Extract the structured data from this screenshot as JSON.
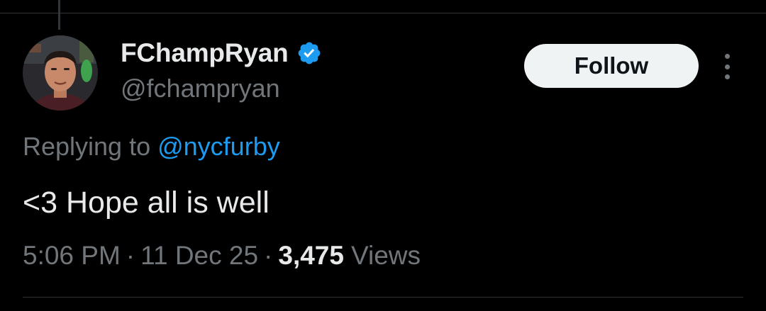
{
  "tweet": {
    "author": {
      "display_name": "FChampRyan",
      "handle": "@fchampryan",
      "verified_icon": "verified-badge-icon",
      "verified_color": "#1d9bf0"
    },
    "follow_label": "Follow",
    "more_icon": "more-vertical-icon",
    "reply": {
      "prefix": "Replying to ",
      "mention": "@nycfurby"
    },
    "text": "<3 Hope all is well",
    "meta": {
      "time": "5:06 PM",
      "separator": "·",
      "date": "11 Dec 25",
      "views_count": "3,475",
      "views_label": "Views"
    }
  },
  "colors": {
    "background": "#000000",
    "primary_text": "#e7e9ea",
    "secondary_text": "#71767b",
    "accent": "#1d9bf0",
    "divider": "#2f3336"
  }
}
